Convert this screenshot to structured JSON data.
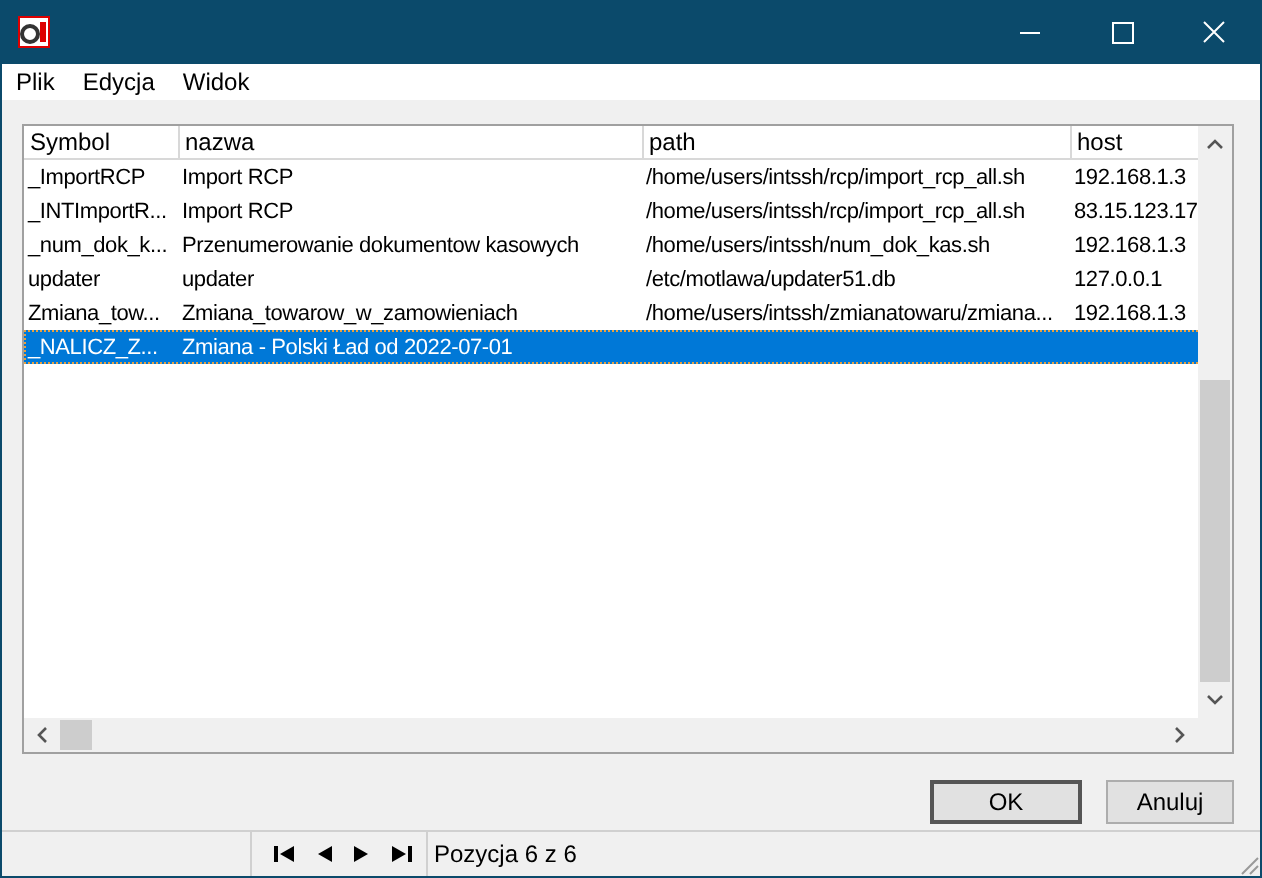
{
  "menu": [
    "Plik",
    "Edycja",
    "Widok"
  ],
  "table": {
    "columns": [
      "Symbol",
      "nazwa",
      "path",
      "host"
    ],
    "rows": [
      {
        "cells": [
          "_ImportRCP",
          "Import RCP",
          "/home/users/intssh/rcp/import_rcp_all.sh",
          "192.168.1.3"
        ],
        "selected": false
      },
      {
        "cells": [
          "_INTImportR...",
          "Import RCP",
          "/home/users/intssh/rcp/import_rcp_all.sh",
          "83.15.123.17"
        ],
        "selected": false
      },
      {
        "cells": [
          "_num_dok_k...",
          "Przenumerowanie dokumentow kasowych",
          "/home/users/intssh/num_dok_kas.sh",
          "192.168.1.3"
        ],
        "selected": false
      },
      {
        "cells": [
          "updater",
          "updater",
          "/etc/motlawa/updater51.db",
          "127.0.0.1"
        ],
        "selected": false
      },
      {
        "cells": [
          "Zmiana_tow...",
          "Zmiana_towarow_w_zamowieniach",
          "/home/users/intssh/zmianatowaru/zmiana...",
          "192.168.1.3"
        ],
        "selected": false
      },
      {
        "cells": [
          "_NALICZ_Z...",
          "Zmiana - Polski Ład od 2022-07-01",
          "",
          ""
        ],
        "selected": true
      }
    ]
  },
  "buttons": [
    "OK",
    "Anuluj"
  ],
  "status_bar": {
    "position": "Pozycja 6 z 6"
  }
}
